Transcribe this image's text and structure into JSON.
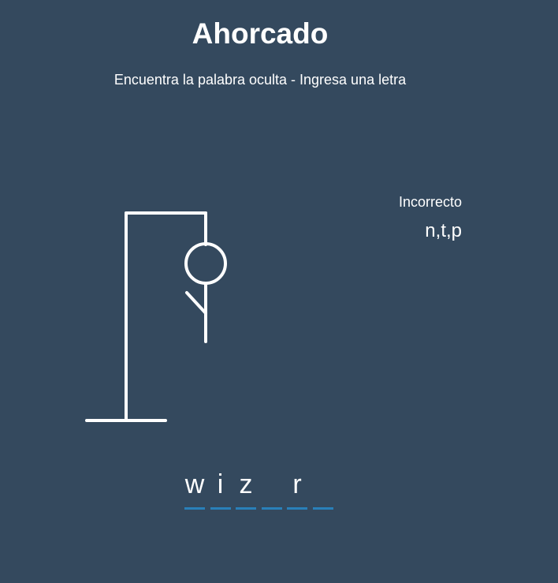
{
  "game": {
    "title": "Ahorcado",
    "subtitle": "Encuentra la palabra oculta - Ingresa una letra"
  },
  "wrong": {
    "title": "Incorrecto",
    "letters": "n,t,p",
    "count": 3
  },
  "word": {
    "slots": [
      "w",
      "i",
      "z",
      "",
      "r",
      ""
    ]
  },
  "colors": {
    "background": "#34495e",
    "figure": "#ffffff",
    "underline": "#2980b9"
  }
}
